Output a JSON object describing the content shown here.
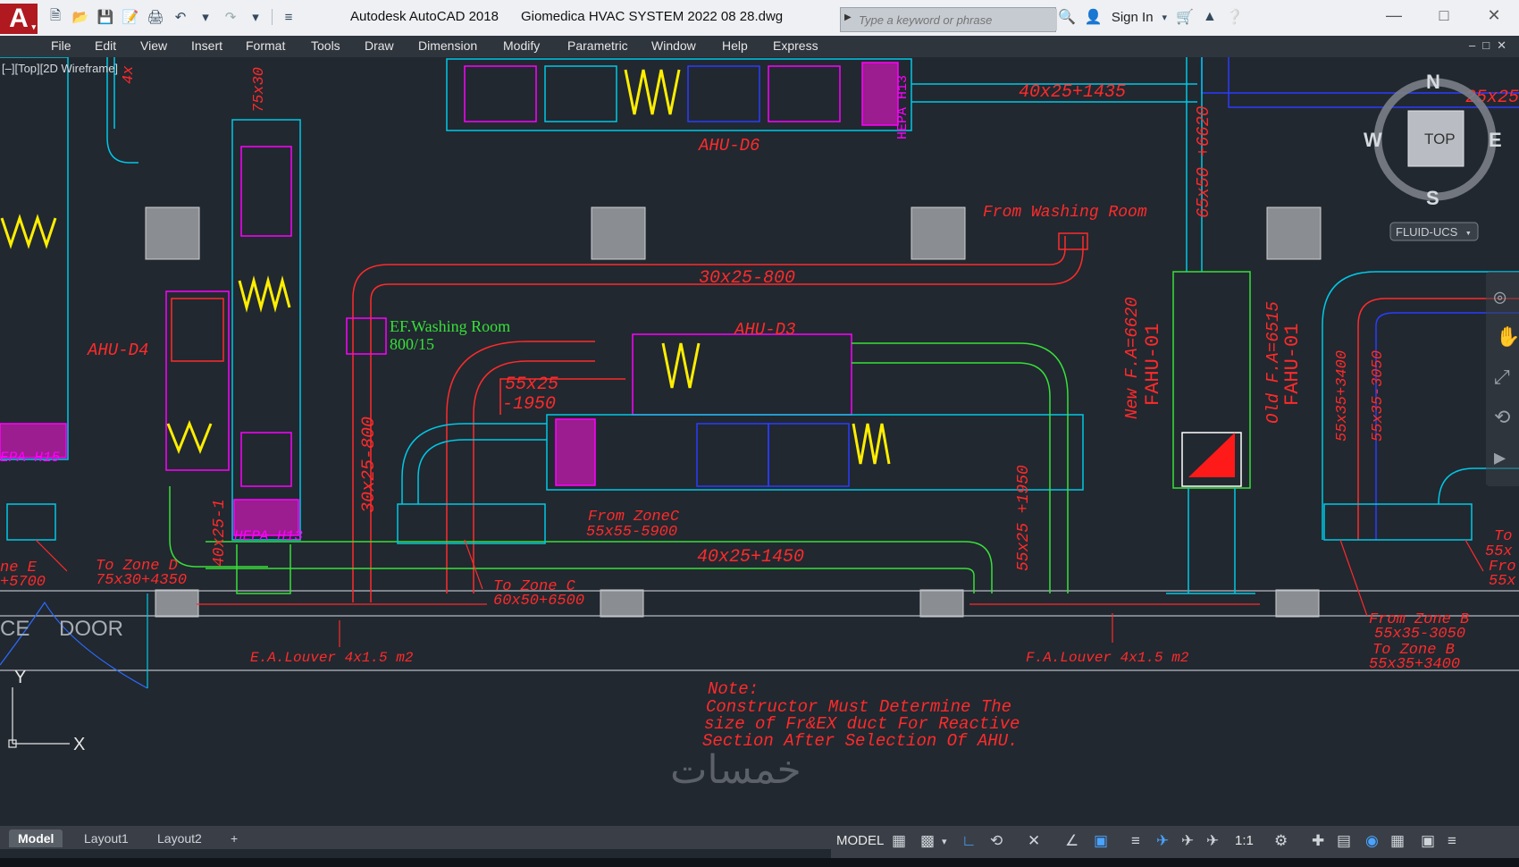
{
  "window": {
    "title": "Autodesk AutoCAD 2018      Giomedica HVAC SYSTEM 2022 08 28.dwg",
    "logo": "A"
  },
  "search": {
    "placeholder": "Type a keyword or phrase"
  },
  "account": {
    "sign_in": "Sign In"
  },
  "menu": [
    "File",
    "Edit",
    "View",
    "Insert",
    "Format",
    "Tools",
    "Draw",
    "Dimension",
    "Modify",
    "Parametric",
    "Window",
    "Help",
    "Express"
  ],
  "viewport": {
    "label": "[–][Top][2D Wireframe]"
  },
  "viewcube": {
    "north": "N",
    "south": "S",
    "east": "E",
    "west": "W",
    "face": "TOP",
    "ucs": "FLUID-UCS"
  },
  "drawing": {
    "ahu_d6": "AHU-D6",
    "ahu_d4": "AHU-D4",
    "ahu_d3": "AHU-D3",
    "duct_top": "40x25+1435",
    "duct_top_right": "25x25",
    "from_washing": "From Washing Room",
    "duct_washing": "30x25-800",
    "ef_washing": "EF.Washing Room",
    "ef_washing_val": "800/15",
    "duct_55x25": "55x25",
    "duct_1950": "-1950",
    "duct_vert": "30x25-800",
    "from_zonec": "From ZoneC",
    "from_zonec_val": "55x55-5900",
    "duct_bottom": "40x25+1450",
    "duct_55x25_1950": "55x25\n+1950",
    "to_zone_d": "To Zone D",
    "to_zone_d_val": "75x30+4350",
    "to_zone_c": "To Zone C",
    "to_zone_c_val": "60x50+6500",
    "zone_e": "ne E",
    "zone_e_val": "+5700",
    "hepa_left": "EPA H15",
    "hepa_mid": "HEPA H13",
    "hepa_top": "HEPA H13",
    "duct_75x30": "75x30\n+4350",
    "duct_40x25_v": "40x25-1",
    "duct_65x50": "65x50\n+6620",
    "new_fa": "New F.A=6620",
    "fahu_new": "FAHU-01",
    "old_fa": "Old F.A=6515",
    "fahu_old": "FAHU-01",
    "duct_55x35_3400": "55x35+3400",
    "duct_55x35_3050": "55x35-3050",
    "from_zone_b": "From Zone B",
    "from_zone_b_val": "55x35-3050",
    "to_zone_b": "To Zone B",
    "to_zone_b_val": "55x35+3400",
    "right_to": "To",
    "right_55": "55x",
    "right_fro": "Fro",
    "right_55b": "55x",
    "ce": "CE",
    "door": "DOOR",
    "ea_louver": "E.A.Louver  4x1.5  m2",
    "fa_louver": "F.A.Louver  4x1.5  m2",
    "note_title": "Note:",
    "note_l1": "Constructor Must Determine The",
    "note_l2": "size of Fr&EX duct For Reactive",
    "note_l3": "Section After Selection Of AHU.",
    "axis_y": "Y",
    "axis_x": "X",
    "top_left_label": "4x"
  },
  "tabs": [
    "Model",
    "Layout1",
    "Layout2",
    "+"
  ],
  "status": {
    "model": "MODEL",
    "scale": "1:1"
  },
  "watermark": "خمسات",
  "colors": {
    "background": "#212830",
    "cyan": "#00c8e6",
    "magenta": "#ff00ff",
    "red": "#ff2a2a",
    "green": "#38e038",
    "yellow": "#ffee00",
    "blue": "#2b3cff"
  }
}
